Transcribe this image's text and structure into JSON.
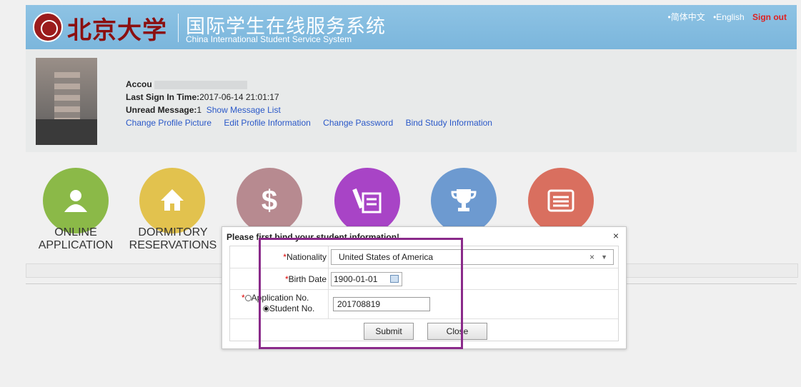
{
  "header": {
    "logo_text": "北京大学",
    "system_title_cn": "国际学生在线服务系统",
    "system_title_en": "China International Student Service System",
    "lang_cn": "•简体中文",
    "lang_en": "•English",
    "sign_out": "Sign out"
  },
  "profile": {
    "account_label": "Accou",
    "last_sign_in_label": "Last Sign In Time:",
    "last_sign_in_value": "2017-06-14 21:01:17",
    "unread_label": "Unread Message:",
    "unread_count": "1",
    "show_message_list": "Show Message List",
    "links": {
      "change_picture": "Change Profile Picture",
      "edit_profile": "Edit Profile Information",
      "change_password": "Change Password",
      "bind_study": "Bind Study Information"
    }
  },
  "modules": [
    {
      "label_line1": "ONLINE",
      "label_line2": "APPLICATION",
      "color": "#8bb948",
      "icon": "user-icon"
    },
    {
      "label_line1": "DORMITORY",
      "label_line2": "RESERVATIONS",
      "color": "#e2c24e",
      "icon": "home-icon"
    },
    {
      "label_line1": "",
      "label_line2": "",
      "color": "#b78a90",
      "icon": "dollar-icon"
    },
    {
      "label_line1": "",
      "label_line2": "",
      "color": "#a844c6",
      "icon": "form-icon"
    },
    {
      "label_line1": "",
      "label_line2": "",
      "color": "#6d9ad0",
      "icon": "trophy-icon"
    },
    {
      "label_line1": "",
      "label_line2": "",
      "color": "#d96f5f",
      "icon": "list-icon"
    }
  ],
  "dialog": {
    "title": "Please first bind your student information!",
    "close": "×",
    "nationality_label": "Nationality",
    "nationality_value": "United States of America",
    "select_clear": "×",
    "select_arrow": "▼",
    "birth_label": "Birth Date",
    "birth_value": "1900-01-01",
    "application_no_label": "Application No.",
    "student_no_label": "Student No.",
    "number_value": "201708819",
    "required_mark": "*",
    "submit": "Submit",
    "close_button": "Close"
  }
}
